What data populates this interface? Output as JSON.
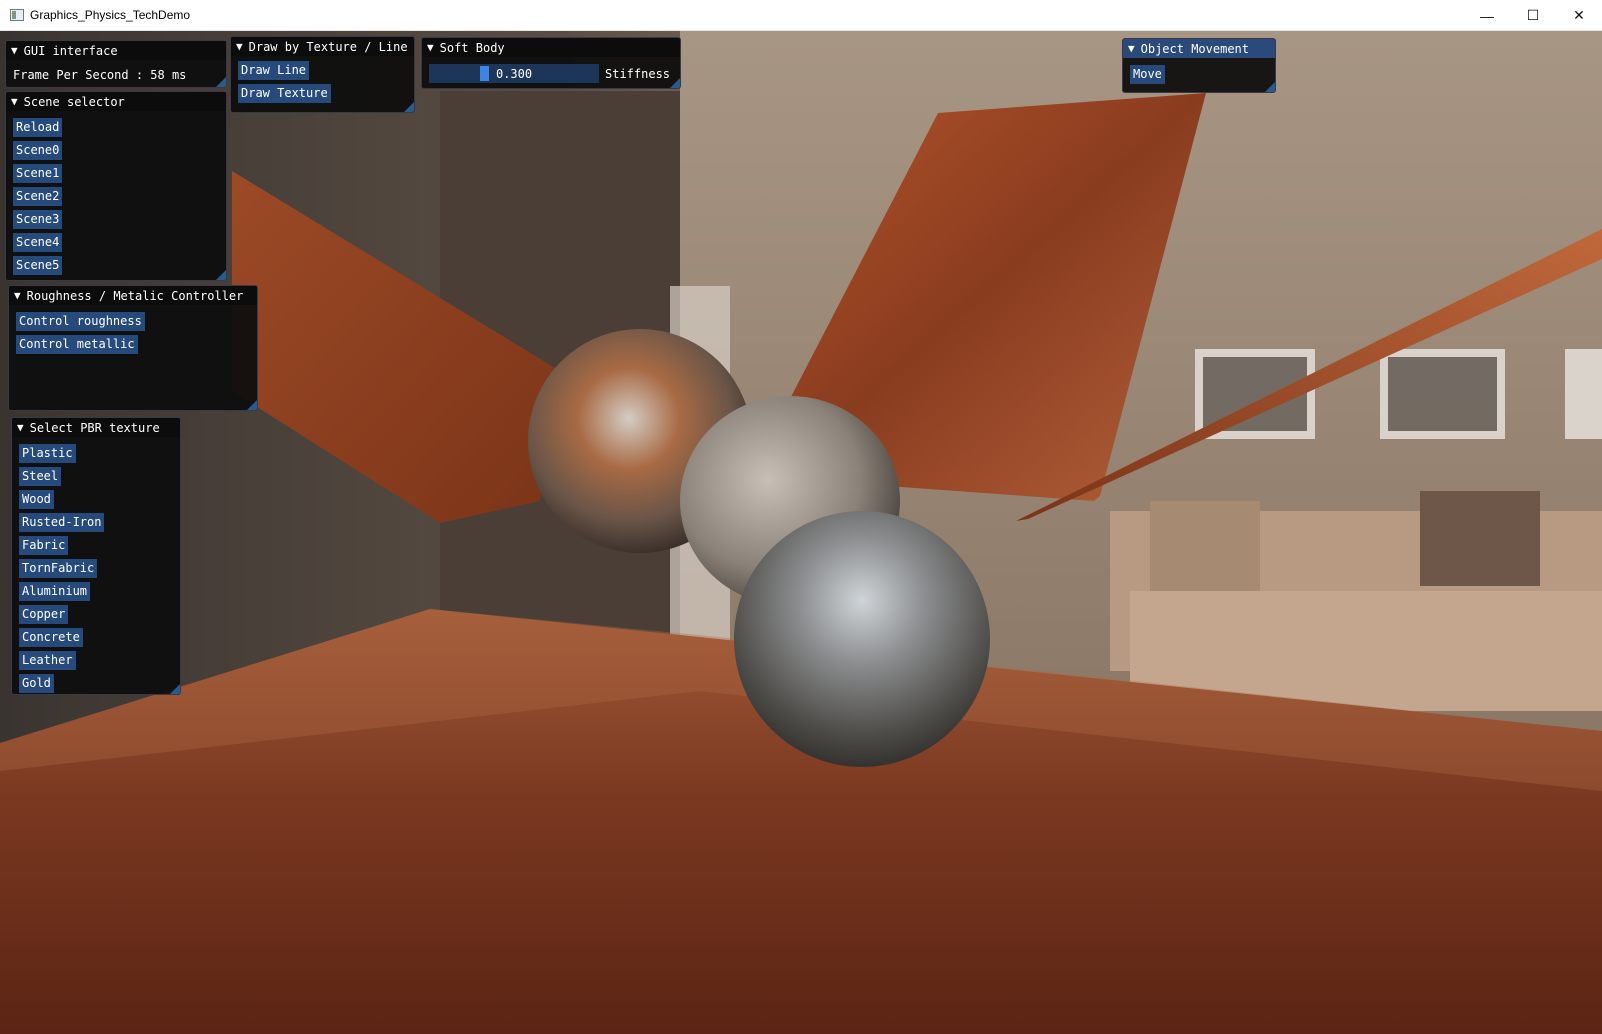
{
  "window": {
    "title": "Graphics_Physics_TechDemo",
    "minimize": "—",
    "maximize": "☐",
    "close": "✕"
  },
  "gui_interface": {
    "header": "GUI interface",
    "fps_text": "Frame Per Second : 58 ms"
  },
  "draw_mode": {
    "header": "Draw by Texture / Line",
    "buttons": [
      "Draw Line",
      "Draw Texture"
    ]
  },
  "soft_body": {
    "header": "Soft Body",
    "stiffness_value": "0.300",
    "stiffness_label": "Stiffness",
    "stiffness_fraction": 0.3
  },
  "object_movement": {
    "header": "Object Movement",
    "buttons": [
      "Move"
    ]
  },
  "scene_selector": {
    "header": "Scene selector",
    "buttons": [
      "Reload",
      "Scene0",
      "Scene1",
      "Scene2",
      "Scene3",
      "Scene4",
      "Scene5"
    ]
  },
  "material_controller": {
    "header": "Roughness / Metalic Controller",
    "buttons": [
      "Control roughness",
      "Control metallic"
    ]
  },
  "pbr_texture": {
    "header": "Select PBR texture",
    "buttons": [
      "Plastic",
      "Steel",
      "Wood",
      "Rusted-Iron",
      "Fabric",
      "TornFabric",
      "Aluminium",
      "Copper",
      "Concrete",
      "Leather",
      "Gold"
    ]
  },
  "icons": {
    "collapse": "triangle-down-icon",
    "resize": "resize-grip-icon",
    "app": "window-app-icon"
  }
}
